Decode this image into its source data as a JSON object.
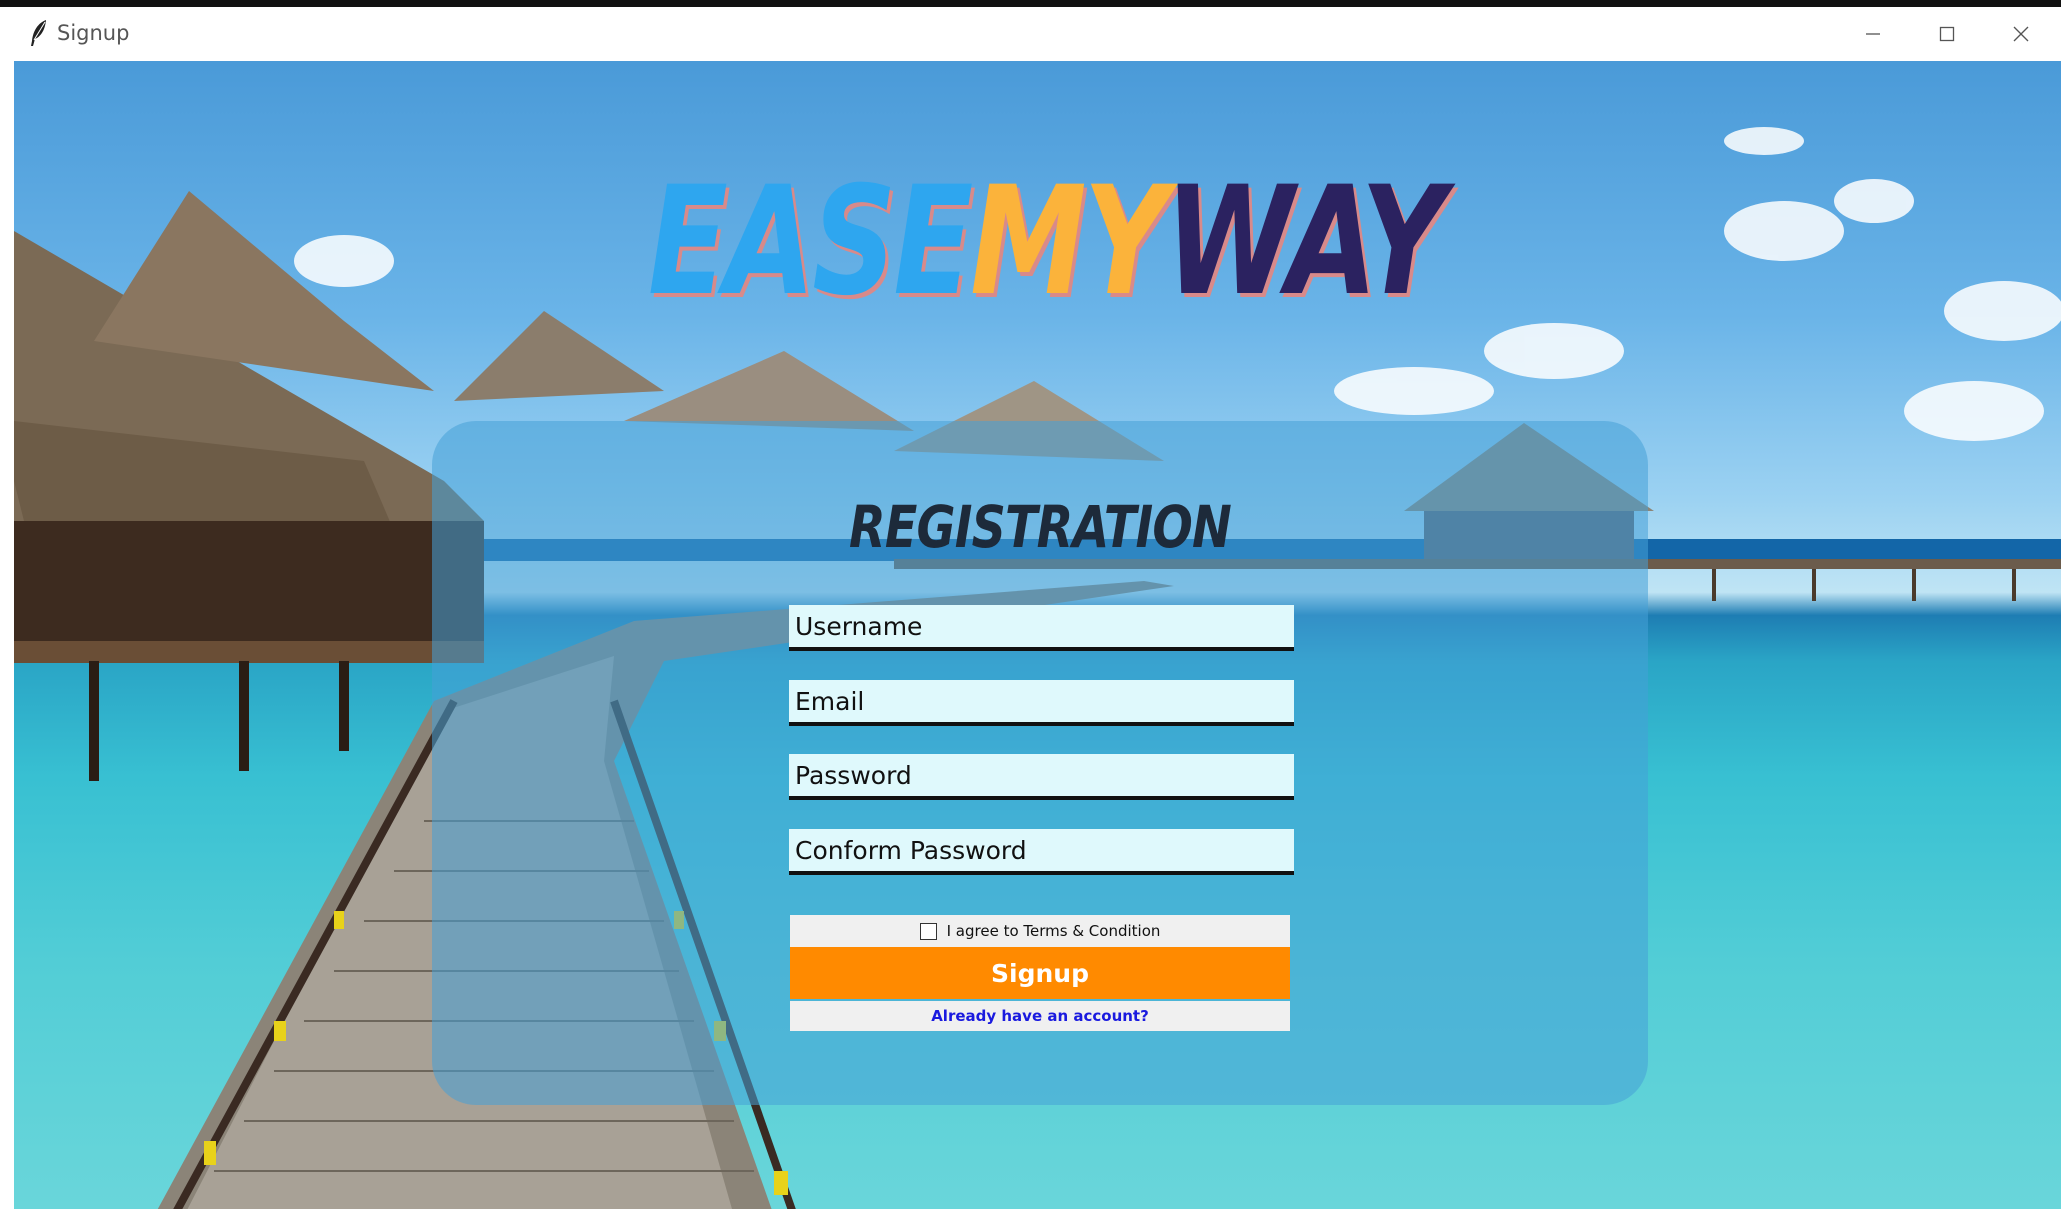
{
  "window": {
    "title": "Signup",
    "icon": "feather-icon"
  },
  "logo": {
    "part1": "EASE",
    "part2": "MY",
    "part3": "WAY"
  },
  "form": {
    "heading": "REGISTRATION",
    "username_placeholder": "Username",
    "email_placeholder": "Email",
    "password_placeholder": "Password",
    "confirm_placeholder": "Conform Password",
    "terms_label": "I agree to Terms & Condition",
    "terms_checked": false,
    "signup_label": "Signup",
    "login_link": "Already have an account?"
  },
  "colors": {
    "logo_blue": "#2ea6ef",
    "logo_yellow": "#fbb33b",
    "logo_navy": "#2b2260",
    "signup_button": "#ff8a00",
    "link": "#1a1adf",
    "field_bg": "#dff9fc"
  }
}
